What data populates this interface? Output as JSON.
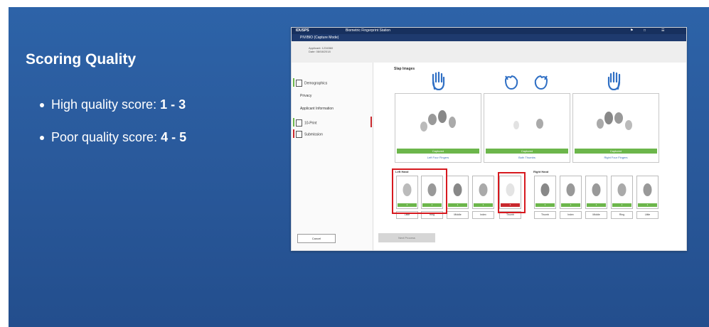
{
  "slide": {
    "title": "Scoring Quality",
    "bullets": [
      {
        "label": "High quality score:",
        "value": "1 - 3"
      },
      {
        "label": "Poor quality score:",
        "value": "4 - 5"
      }
    ]
  },
  "app": {
    "brand": "IDUSPS",
    "center_title": "Biometric Fingerprint Station",
    "subtitle": "PIV/BIO (Capture Mode)",
    "applicant": [
      "Applicant: 1234560",
      "Date: 08/08/2018"
    ],
    "sidebar": [
      {
        "label": "Demographics"
      },
      {
        "label": "Privacy"
      },
      {
        "label": "Applicant Information"
      },
      {
        "label": "10-Print"
      },
      {
        "label": "Submission"
      }
    ],
    "cancel_label": "Cancel",
    "next_label": "Next Process",
    "slap_section": "Slap Images",
    "slaps": [
      {
        "status": "Captured",
        "caption": "Left Four Fingers"
      },
      {
        "status": "Captured",
        "caption": "Both Thumbs"
      },
      {
        "status": "Captured",
        "caption": "Right Four Fingers"
      }
    ],
    "left_hand_label": "Left Hand",
    "right_hand_label": "Right Hand",
    "fingers": [
      {
        "name": "Little",
        "score": "2",
        "poor": false
      },
      {
        "name": "Ring",
        "score": "1",
        "poor": false
      },
      {
        "name": "Middle",
        "score": "1",
        "poor": false
      },
      {
        "name": "Index",
        "score": "1",
        "poor": false
      },
      {
        "name": "Thumb",
        "score": "4",
        "poor": true
      },
      {
        "name": "Thumb",
        "score": "1",
        "poor": false
      },
      {
        "name": "Index",
        "score": "1",
        "poor": false
      },
      {
        "name": "Middle",
        "score": "1",
        "poor": false
      },
      {
        "name": "Ring",
        "score": "1",
        "poor": false
      },
      {
        "name": "Little",
        "score": "1",
        "poor": false
      }
    ]
  },
  "colors": {
    "slide_blue": "#2a5a9c",
    "good_green": "#6cb64b",
    "poor_red": "#c9282d",
    "highlight_red": "#d7191f",
    "hand_blue": "#2f6fc4"
  }
}
